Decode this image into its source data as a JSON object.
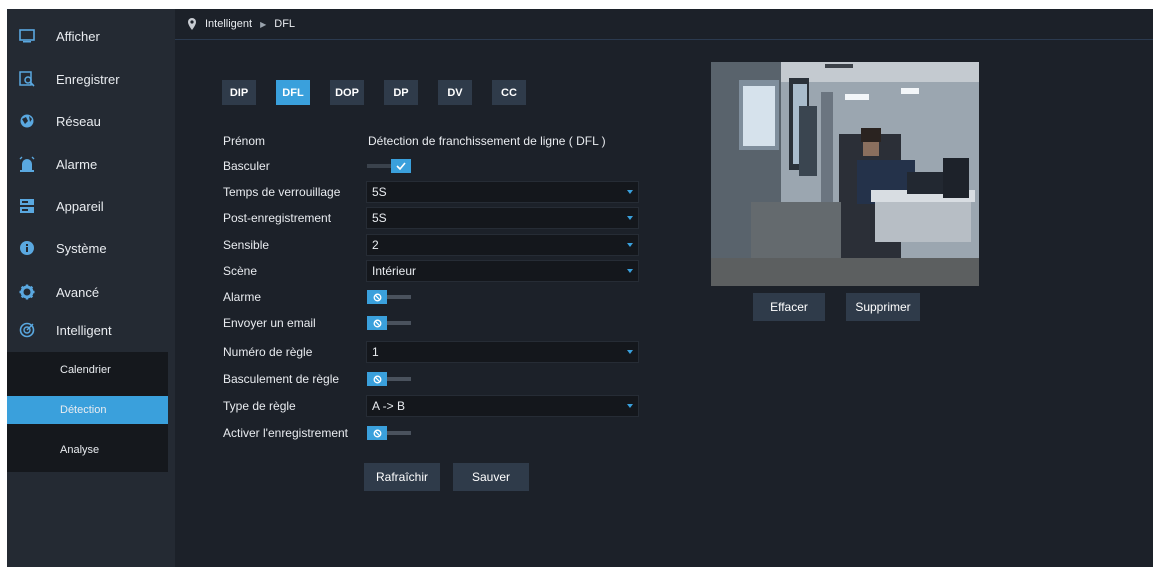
{
  "sidebar": {
    "items": [
      {
        "label": "Afficher",
        "icon": "monitor-icon"
      },
      {
        "label": "Enregistrer",
        "icon": "record-search-icon"
      },
      {
        "label": "Réseau",
        "icon": "network-globe-icon"
      },
      {
        "label": "Alarme",
        "icon": "alarm-light-icon"
      },
      {
        "label": "Appareil",
        "icon": "device-storage-icon"
      },
      {
        "label": "Système",
        "icon": "info-icon"
      },
      {
        "label": "Avancé",
        "icon": "gear-icon"
      },
      {
        "label": "Intelligent",
        "icon": "intelligent-icon"
      }
    ],
    "sub_items": [
      {
        "label": "Calendrier",
        "active": false
      },
      {
        "label": "Détection",
        "active": true
      },
      {
        "label": "Analyse",
        "active": false
      }
    ]
  },
  "breadcrumb": {
    "parent": "Intelligent",
    "current": "DFL"
  },
  "tabs": [
    {
      "label": "DIP",
      "active": false
    },
    {
      "label": "DFL",
      "active": true
    },
    {
      "label": "DOP",
      "active": false
    },
    {
      "label": "DP",
      "active": false
    },
    {
      "label": "DV",
      "active": false
    },
    {
      "label": "CC",
      "active": false
    }
  ],
  "form": {
    "prenom": {
      "label": "Prénom",
      "value": "Détection de franchissement de ligne ( DFL )"
    },
    "basculer": {
      "label": "Basculer",
      "on": true
    },
    "verrouillage": {
      "label": "Temps de verrouillage",
      "value": "5S"
    },
    "post_enregistrement": {
      "label": "Post-enregistrement",
      "value": "5S"
    },
    "sensible": {
      "label": "Sensible",
      "value": "2"
    },
    "scene": {
      "label": "Scène",
      "value": "Intérieur"
    },
    "alarme": {
      "label": "Alarme",
      "on": false
    },
    "email": {
      "label": "Envoyer un email",
      "on": false
    },
    "numero_regle": {
      "label": "Numéro de règle",
      "value": "1"
    },
    "basculement_regle": {
      "label": "Basculement de règle",
      "on": false
    },
    "type_regle": {
      "label": "Type de règle",
      "value": "A -> B"
    },
    "activer_enregistrement": {
      "label": "Activer l'enregistrement",
      "on": false
    }
  },
  "buttons": {
    "rafraichir": "Rafraîchir",
    "sauver": "Sauver",
    "effacer": "Effacer",
    "supprimer": "Supprimer"
  },
  "colors": {
    "accent": "#3aa0dc",
    "sidebar": "#242a33",
    "background": "#1c2129",
    "button": "#2f3b4a"
  }
}
